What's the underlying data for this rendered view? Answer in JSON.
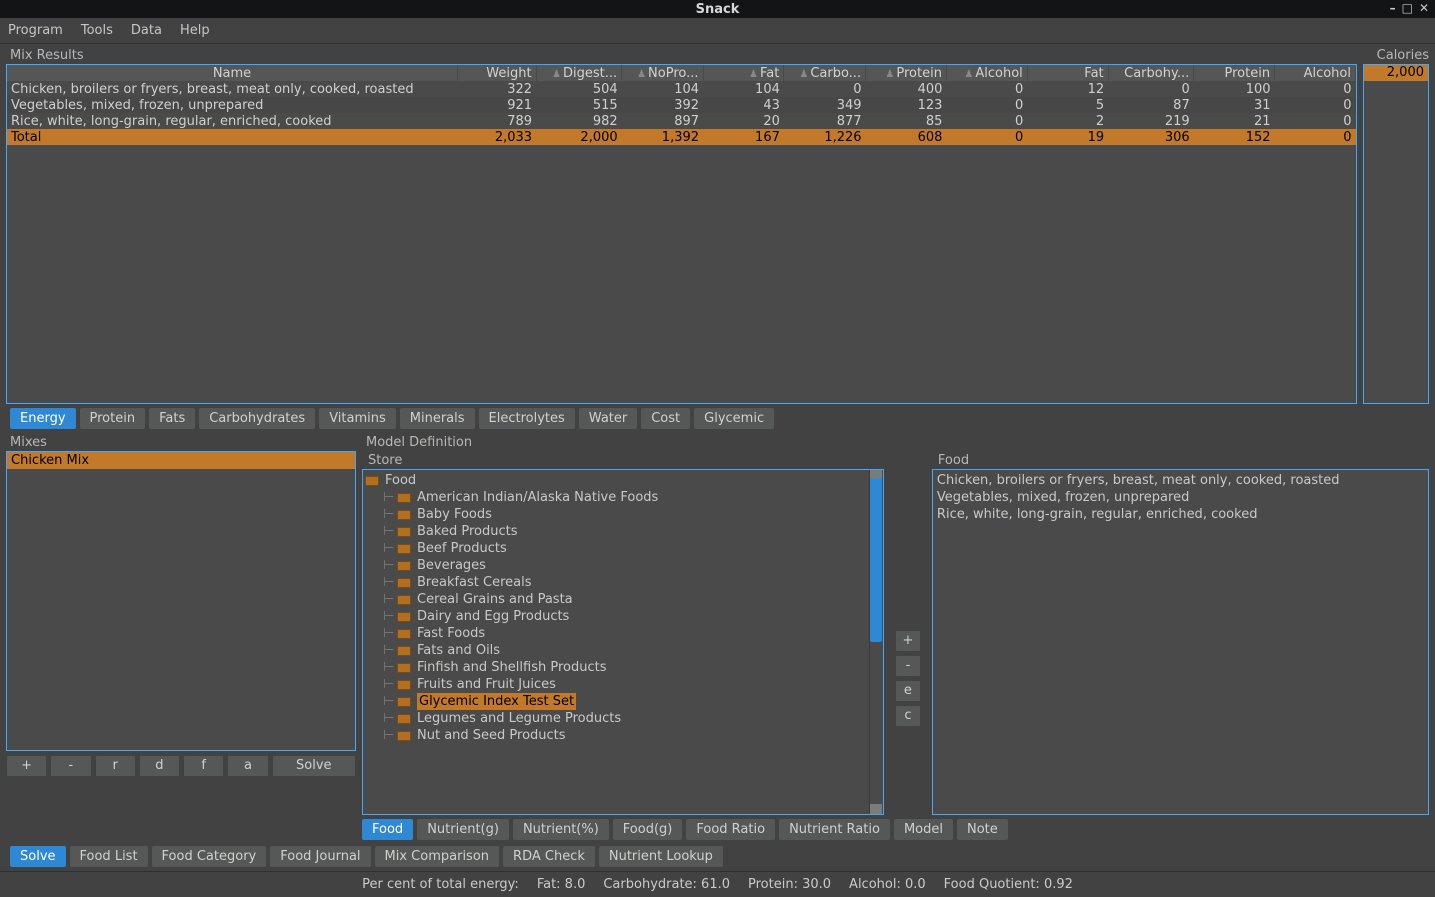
{
  "window": {
    "title": "Snack"
  },
  "menubar": [
    "Program",
    "Tools",
    "Data",
    "Help"
  ],
  "mix_results": {
    "label": "Mix Results",
    "columns": [
      "Name",
      "Weight",
      "Digest...",
      "NoPro...",
      "Fat",
      "Carbo...",
      "Protein",
      "Alcohol",
      "Fat",
      "Carbohy...",
      "Protein",
      "Alcohol"
    ],
    "rows": [
      {
        "name": "Chicken, broilers or fryers, breast, meat only, cooked, roasted",
        "vals": [
          "322",
          "504",
          "104",
          "104",
          "0",
          "400",
          "0",
          "12",
          "0",
          "100",
          "0"
        ]
      },
      {
        "name": "Vegetables, mixed, frozen, unprepared",
        "vals": [
          "921",
          "515",
          "392",
          "43",
          "349",
          "123",
          "0",
          "5",
          "87",
          "31",
          "0"
        ]
      },
      {
        "name": "Rice, white, long-grain, regular, enriched, cooked",
        "vals": [
          "789",
          "982",
          "897",
          "20",
          "877",
          "85",
          "0",
          "2",
          "219",
          "21",
          "0"
        ]
      }
    ],
    "total": {
      "name": "Total",
      "vals": [
        "2,033",
        "2,000",
        "1,392",
        "167",
        "1,226",
        "608",
        "0",
        "19",
        "306",
        "152",
        "0"
      ]
    }
  },
  "calories": {
    "label": "Calories",
    "value": "2,000"
  },
  "energy_tabs": [
    "Energy",
    "Protein",
    "Fats",
    "Carbohydrates",
    "Vitamins",
    "Minerals",
    "Electrolytes",
    "Water",
    "Cost",
    "Glycemic"
  ],
  "mixes": {
    "label": "Mixes",
    "items": [
      "Chicken Mix"
    ],
    "buttons": [
      "+",
      "-",
      "r",
      "d",
      "f",
      "a",
      "Solve"
    ]
  },
  "model": {
    "label": "Model Definition",
    "store_label": "Store",
    "tree_root": "Food",
    "tree_children": [
      "American Indian/Alaska Native Foods",
      "Baby Foods",
      "Baked Products",
      "Beef Products",
      "Beverages",
      "Breakfast Cereals",
      "Cereal Grains and Pasta",
      "Dairy and Egg Products",
      "Fast Foods",
      "Fats and Oils",
      "Finfish and Shellfish Products",
      "Fruits and Fruit Juices",
      "Glycemic Index Test Set",
      "Legumes and Legume Products",
      "Nut and Seed Products"
    ],
    "tree_selected_index": 12,
    "addrem": [
      "+",
      "-",
      "e",
      "c"
    ],
    "food_label": "Food",
    "food_items": [
      "Chicken, broilers or fryers, breast, meat only, cooked, roasted",
      "Vegetables, mixed, frozen, unprepared",
      "Rice, white, long-grain, regular, enriched, cooked"
    ],
    "tabs": [
      "Food",
      "Nutrient(g)",
      "Nutrient(%)",
      "Food(g)",
      "Food Ratio",
      "Nutrient Ratio",
      "Model",
      "Note"
    ]
  },
  "bottom_tabs": [
    "Solve",
    "Food List",
    "Food Category",
    "Food Journal",
    "Mix Comparison",
    "RDA Check",
    "Nutrient Lookup"
  ],
  "status": {
    "lead": "Per cent of total energy:",
    "fat": "Fat: 8.0",
    "carb": "Carbohydrate: 61.0",
    "prot": "Protein: 30.0",
    "alc": "Alcohol: 0.0",
    "fq": "Food Quotient: 0.92"
  },
  "colors": {
    "accent_orange": "#c27a2a",
    "accent_blue": "#2e88d4",
    "frame_blue": "#3fa9ff"
  }
}
